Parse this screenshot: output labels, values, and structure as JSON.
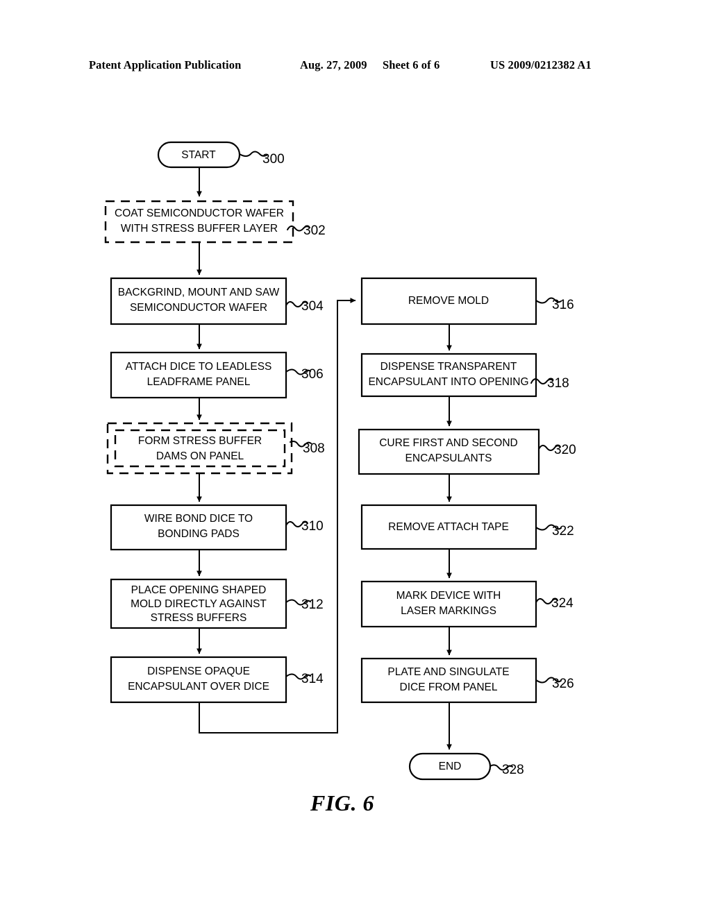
{
  "header": {
    "publication": "Patent Application Publication",
    "date": "Aug. 27, 2009",
    "sheet": "Sheet 6 of 6",
    "patent_number": "US 2009/0212382 A1"
  },
  "figure": {
    "caption": "FIG. 6",
    "type": "flowchart"
  },
  "flowchart": {
    "terminals": [
      {
        "id": "start",
        "label": "START",
        "ref": "300"
      },
      {
        "id": "end",
        "label": "END",
        "ref": "328"
      }
    ],
    "steps": [
      {
        "ref": "302",
        "line1": "COAT SEMICONDUCTOR WAFER",
        "line2": "WITH STRESS BUFFER LAYER",
        "line3": "",
        "style": "dashed",
        "column": "left"
      },
      {
        "ref": "304",
        "line1": "BACKGRIND, MOUNT AND SAW",
        "line2": "SEMICONDUCTOR WAFER",
        "line3": "",
        "style": "solid",
        "column": "left"
      },
      {
        "ref": "306",
        "line1": "ATTACH DICE TO LEADLESS",
        "line2": "LEADFRAME PANEL",
        "line3": "",
        "style": "solid",
        "column": "left"
      },
      {
        "ref": "308",
        "line1": "FORM STRESS BUFFER",
        "line2": "DAMS ON PANEL",
        "line3": "",
        "style": "double-dashed",
        "column": "left"
      },
      {
        "ref": "310",
        "line1": "WIRE BOND DICE TO",
        "line2": "BONDING PADS",
        "line3": "",
        "style": "solid",
        "column": "left"
      },
      {
        "ref": "312",
        "line1": "PLACE OPENING SHAPED",
        "line2": "MOLD DIRECTLY AGAINST",
        "line3": "STRESS BUFFERS",
        "style": "solid",
        "column": "left"
      },
      {
        "ref": "314",
        "line1": "DISPENSE OPAQUE",
        "line2": "ENCAPSULANT OVER DICE",
        "line3": "",
        "style": "solid",
        "column": "left"
      },
      {
        "ref": "316",
        "line1": "REMOVE MOLD",
        "line2": "",
        "line3": "",
        "style": "solid",
        "column": "right"
      },
      {
        "ref": "318",
        "line1": "DISPENSE TRANSPARENT",
        "line2": "ENCAPSULANT INTO OPENING",
        "line3": "",
        "style": "solid",
        "column": "right"
      },
      {
        "ref": "320",
        "line1": "CURE FIRST AND SECOND",
        "line2": "ENCAPSULANTS",
        "line3": "",
        "style": "solid",
        "column": "right"
      },
      {
        "ref": "322",
        "line1": "REMOVE ATTACH TAPE",
        "line2": "",
        "line3": "",
        "style": "solid",
        "column": "right"
      },
      {
        "ref": "324",
        "line1": "MARK DEVICE WITH",
        "line2": "LASER MARKINGS",
        "line3": "",
        "style": "solid",
        "column": "right"
      },
      {
        "ref": "326",
        "line1": "PLATE AND SINGULATE",
        "line2": "DICE FROM PANEL",
        "line3": "",
        "style": "solid",
        "column": "right"
      }
    ]
  }
}
